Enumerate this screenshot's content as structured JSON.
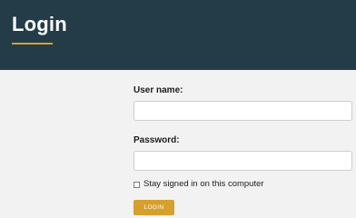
{
  "header": {
    "title": "Login"
  },
  "form": {
    "username_label": "User name:",
    "username_value": "",
    "password_label": "Password:",
    "password_value": "",
    "remember_label": "Stay signed in on this computer",
    "remember_checked": false,
    "login_button_label": "LOGIN"
  },
  "colors": {
    "header_background": "#233c48",
    "accent": "#d6a02d",
    "page_background": "#f2f2f2"
  }
}
